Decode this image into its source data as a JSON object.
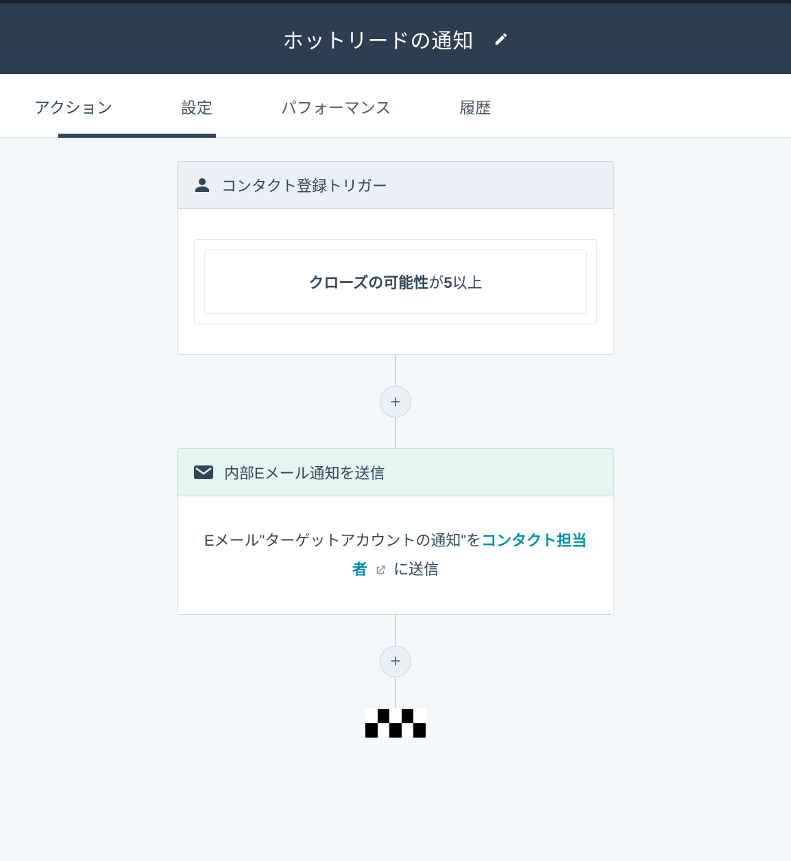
{
  "header": {
    "title": "ホットリードの通知"
  },
  "tabs": [
    {
      "id": "actions",
      "label": "アクション",
      "active": true
    },
    {
      "id": "settings",
      "label": "設定",
      "active": false
    },
    {
      "id": "performance",
      "label": "パフォーマンス",
      "active": false
    },
    {
      "id": "history",
      "label": "履歴",
      "active": false
    }
  ],
  "trigger": {
    "title": "コンタクト登録トリガー",
    "condition_property": "クローズの可能性",
    "condition_middle": "が",
    "condition_value": "5",
    "condition_suffix": "以上"
  },
  "action": {
    "title": "内部Eメール通知を送信",
    "body_prefix": "Eメール\"ターゲットアカウントの通知\"を",
    "body_link": "コンタクト担当者",
    "body_suffix": "に送信"
  },
  "buttons": {
    "plus": "+"
  }
}
